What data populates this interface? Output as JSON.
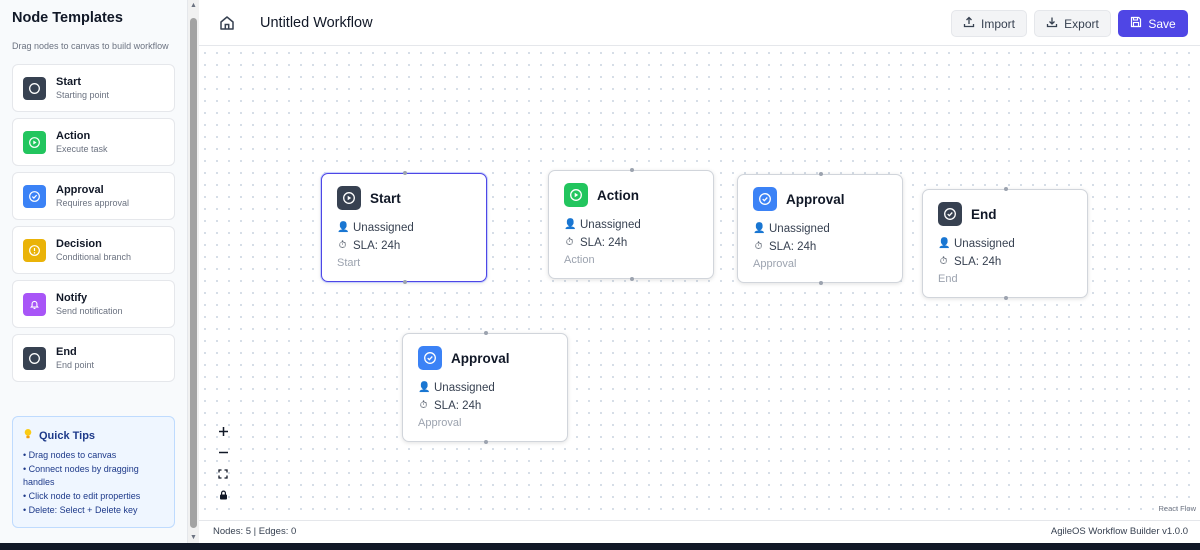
{
  "sidebar": {
    "title": "Node Templates",
    "subtitle": "Drag nodes to canvas to build workflow",
    "templates": [
      {
        "name": "Start",
        "desc": "Starting point",
        "color": "#374151",
        "icon": "circle-icon"
      },
      {
        "name": "Action",
        "desc": "Execute task",
        "color": "#22c55e",
        "icon": "play-icon"
      },
      {
        "name": "Approval",
        "desc": "Requires approval",
        "color": "#3b82f6",
        "icon": "check-circle-icon"
      },
      {
        "name": "Decision",
        "desc": "Conditional branch",
        "color": "#eab308",
        "icon": "alert-circle-icon"
      },
      {
        "name": "Notify",
        "desc": "Send notification",
        "color": "#a855f7",
        "icon": "bell-icon"
      },
      {
        "name": "End",
        "desc": "End point",
        "color": "#374151",
        "icon": "circle-icon"
      }
    ],
    "tips": {
      "title": "Quick Tips",
      "items": [
        "Drag nodes to canvas",
        "Connect nodes by dragging handles",
        "Click node to edit properties",
        "Delete: Select + Delete key"
      ]
    }
  },
  "header": {
    "title": "Untitled Workflow",
    "import_label": "Import",
    "export_label": "Export",
    "save_label": "Save"
  },
  "canvas": {
    "nodes": [
      {
        "title": "Start",
        "assignee": "Unassigned",
        "sla": "SLA: 24h",
        "type": "Start",
        "color": "#374151",
        "icon": "play-circle-icon",
        "selected": true
      },
      {
        "title": "Action",
        "assignee": "Unassigned",
        "sla": "SLA: 24h",
        "type": "Action",
        "color": "#22c55e",
        "icon": "play-circle-icon",
        "selected": false
      },
      {
        "title": "Approval",
        "assignee": "Unassigned",
        "sla": "SLA: 24h",
        "type": "Approval",
        "color": "#3b82f6",
        "icon": "check-circle-icon",
        "selected": false
      },
      {
        "title": "End",
        "assignee": "Unassigned",
        "sla": "SLA: 24h",
        "type": "End",
        "color": "#374151",
        "icon": "check-circle-icon",
        "selected": false
      },
      {
        "title": "Approval",
        "assignee": "Unassigned",
        "sla": "SLA: 24h",
        "type": "Approval",
        "color": "#3b82f6",
        "icon": "check-circle-icon",
        "selected": false
      }
    ],
    "attribution": "React Flow"
  },
  "footer": {
    "stats": "Nodes: 5 | Edges: 0",
    "version": "AgileOS Workflow Builder v1.0.0"
  }
}
